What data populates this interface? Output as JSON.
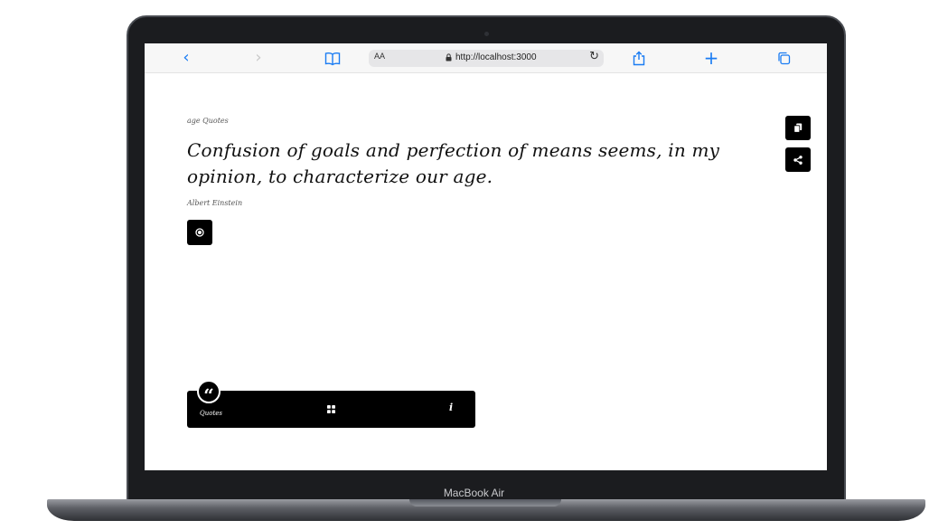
{
  "browser": {
    "nav": {
      "back": "‹",
      "forward": "›",
      "new_tab": "+"
    },
    "address": {
      "text_size": "AA",
      "url": "http://localhost:3000",
      "reload": "↻"
    }
  },
  "page": {
    "category": "age Quotes",
    "quote": "Confusion of goals and perfection of means seems, in my opinion, to characterize our age.",
    "author": "Albert Einstein"
  },
  "bottom_nav": {
    "quotes_label": "Quotes",
    "quotes_badge": "“",
    "info": "i"
  },
  "device": {
    "label": "MacBook Air"
  },
  "icons": {
    "back": "chevron-left-icon",
    "forward": "chevron-right-icon",
    "bookmarks": "book-icon",
    "lock": "lock-icon",
    "reload": "reload-icon",
    "share": "share-icon",
    "new_tab": "plus-icon",
    "tabs": "tabs-icon",
    "copy": "copy-icon",
    "share_quote": "share-nodes-icon",
    "speak": "record-icon",
    "grid": "grid-icon",
    "info": "info-icon"
  },
  "colors": {
    "accent": "#1a7cf3",
    "button_bg": "#000000",
    "lid": "#1b1c1f"
  }
}
